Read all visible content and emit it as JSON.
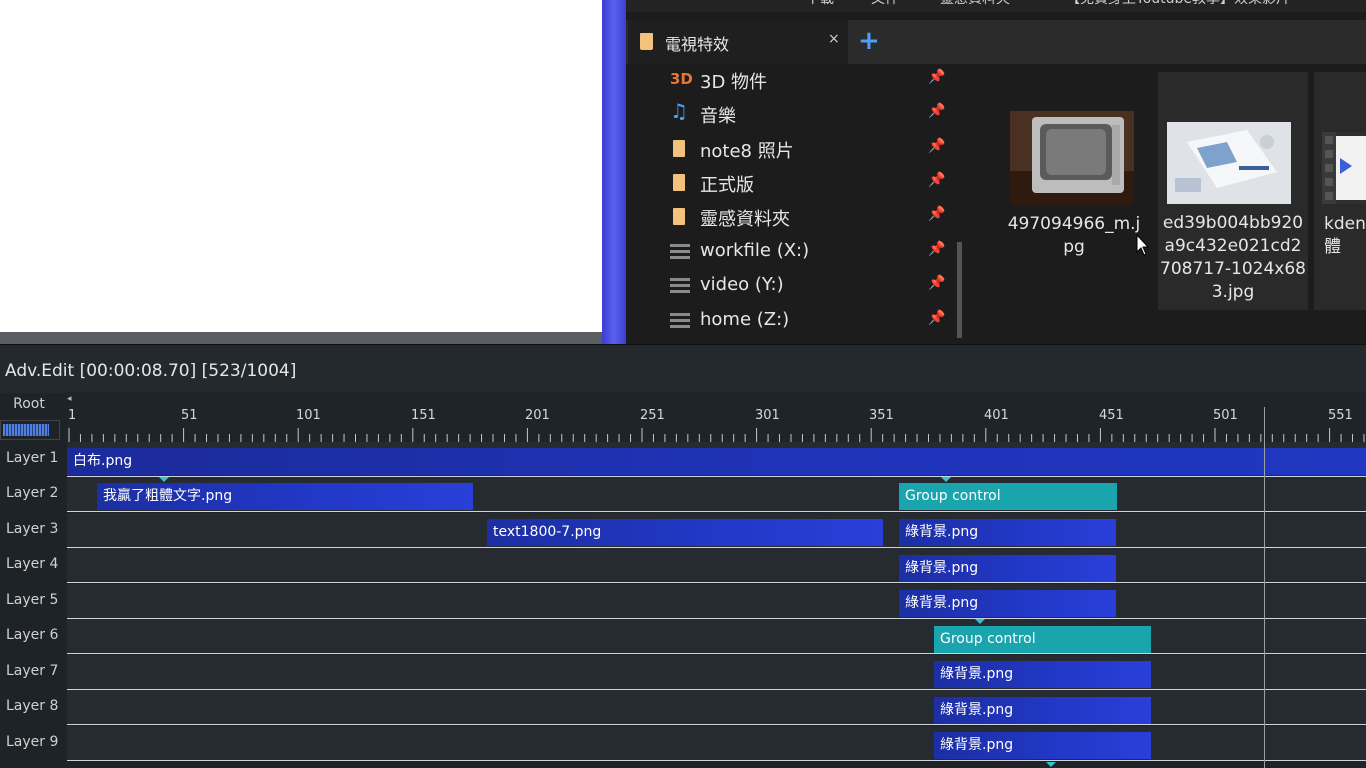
{
  "explorer": {
    "quick_bar": [
      "<",
      "下載",
      "文件",
      "靈感資料夾",
      "【免費身上Youtube教學】效果影片"
    ],
    "tab": {
      "label": "電視特效",
      "close": "×",
      "add": "+"
    },
    "nav_items": [
      {
        "icon": "3d-objects-icon",
        "icon_text": "3D",
        "label": "3D 物件",
        "pin": "📌"
      },
      {
        "icon": "music-icon",
        "icon_text": "♫",
        "label": "音樂",
        "pin": "📌"
      },
      {
        "icon": "folder-icon",
        "icon_text": "",
        "label": "note8 照片",
        "pin": "📌"
      },
      {
        "icon": "folder-icon",
        "icon_text": "",
        "label": "正式版",
        "pin": "📌"
      },
      {
        "icon": "folder-icon",
        "icon_text": "",
        "label": "靈感資料夾",
        "pin": "📌"
      },
      {
        "icon": "drive-icon",
        "icon_text": "",
        "label": "workfile (X:)",
        "pin": "📌"
      },
      {
        "icon": "drive-icon",
        "icon_text": "",
        "label": "video (Y:)",
        "pin": "📌"
      },
      {
        "icon": "drive-icon",
        "icon_text": "",
        "label": "home (Z:)",
        "pin": "📌"
      }
    ],
    "files": [
      {
        "name": "497094966_m.jpg",
        "thumb": "tv-photo"
      },
      {
        "name": "ed39b004bb920a9c432e021cd2708717-1024x683.jpg",
        "thumb": "desk-photo"
      },
      {
        "name": "kden軟體",
        "thumb": "video-file"
      }
    ]
  },
  "timeline": {
    "title": "Adv.Edit [00:00:08.70] [523/1004]",
    "root_label": "Root",
    "ruler_labels": [
      "1",
      "51",
      "101",
      "151",
      "201",
      "251",
      "301",
      "351",
      "401",
      "451",
      "501",
      "551"
    ],
    "layers": [
      {
        "label": "Layer 1",
        "clips": [
          {
            "text": "白布.png",
            "kind": "img"
          }
        ]
      },
      {
        "label": "Layer 2",
        "clips": [
          {
            "text": "我贏了粗體文字.png",
            "kind": "img"
          },
          {
            "text": "Group control",
            "kind": "grp"
          }
        ]
      },
      {
        "label": "Layer 3",
        "clips": [
          {
            "text": "text1800-7.png",
            "kind": "img"
          },
          {
            "text": "綠背景.png",
            "kind": "img"
          }
        ]
      },
      {
        "label": "Layer 4",
        "clips": [
          {
            "text": "綠背景.png",
            "kind": "img"
          }
        ]
      },
      {
        "label": "Layer 5",
        "clips": [
          {
            "text": "綠背景.png",
            "kind": "img"
          }
        ]
      },
      {
        "label": "Layer 6",
        "clips": [
          {
            "text": "Group control",
            "kind": "grp"
          }
        ]
      },
      {
        "label": "Layer 7",
        "clips": [
          {
            "text": "綠背景.png",
            "kind": "img"
          }
        ]
      },
      {
        "label": "Layer 8",
        "clips": [
          {
            "text": "綠背景.png",
            "kind": "img"
          }
        ]
      },
      {
        "label": "Layer 9",
        "clips": [
          {
            "text": "綠背景.png",
            "kind": "img"
          }
        ]
      }
    ]
  }
}
